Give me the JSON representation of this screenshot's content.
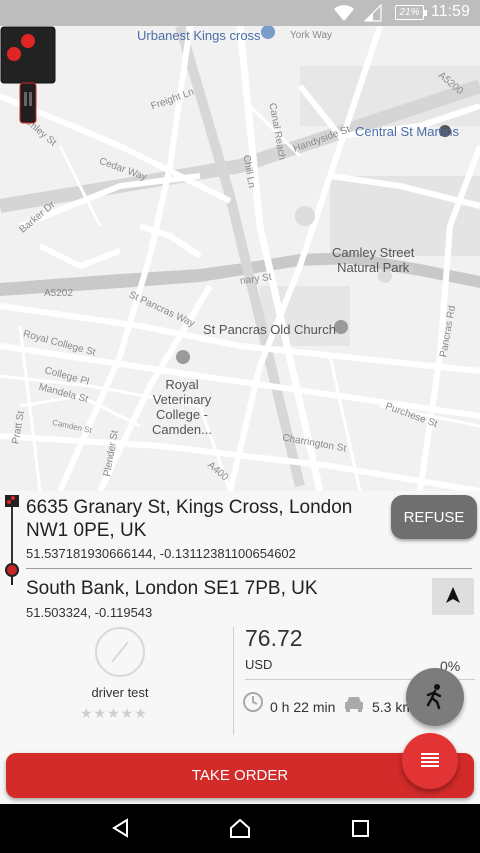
{
  "status_bar": {
    "battery": "21%",
    "time": "11:59"
  },
  "map": {
    "labels": {
      "urbanest": "Urbanest Kings cross",
      "york_way": "York Way",
      "a5200": "A5200",
      "freight_ln": "Freight Ln",
      "camley_st": "Camley St",
      "canal_reach": "Canal Reach",
      "handyside_st": "Handyside St",
      "central_st_martins": "Central St Martins",
      "cedar_way": "Cedar Way",
      "chill_ln": "Chill Ln",
      "barker_dr": "Barker Dr",
      "camley_street_park_1": "Camley Street",
      "camley_street_park_2": "Natural Park",
      "granary_st": "nary St",
      "a5202": "A5202",
      "st_pancras_way": "St Pancras Way",
      "st_pancras_church": "St Pancras Old Church",
      "pancras_rd": "Pancras Rd",
      "royal_college_st": "Royal College St",
      "rvc_1": "Royal",
      "rvc_2": "Veterinary",
      "rvc_3": "College -",
      "rvc_4": "Camden...",
      "college_pl": "College Pl",
      "mandela_st": "Mandela St",
      "camden_st": "Camden St",
      "pratt_st": "Pratt St",
      "plender_st": "Plender St",
      "purchese_st": "Purchese St",
      "charrington_st": "Charrington St",
      "a400": "A400"
    }
  },
  "order": {
    "pickup_address": "6635 Granary St, Kings Cross, London NW1 0PE, UK",
    "pickup_coords": "51.537181930666144, -0.13112381100654602",
    "destination_address": "South Bank, London SE1 7PB, UK",
    "destination_coords": "51.503324, -0.119543",
    "refuse_label": "REFUSE",
    "driver_name": "driver test",
    "rating_stars": "★★★★★",
    "price": "76.72",
    "currency": "USD",
    "percent": "0%",
    "duration": "0 h 22 min",
    "distance": "5.3 km",
    "take_order_label": "TAKE ORDER"
  },
  "colors": {
    "accent_red": "#d32a2a",
    "status_bar": "#bdbdbd",
    "nav_bar": "#000000"
  }
}
